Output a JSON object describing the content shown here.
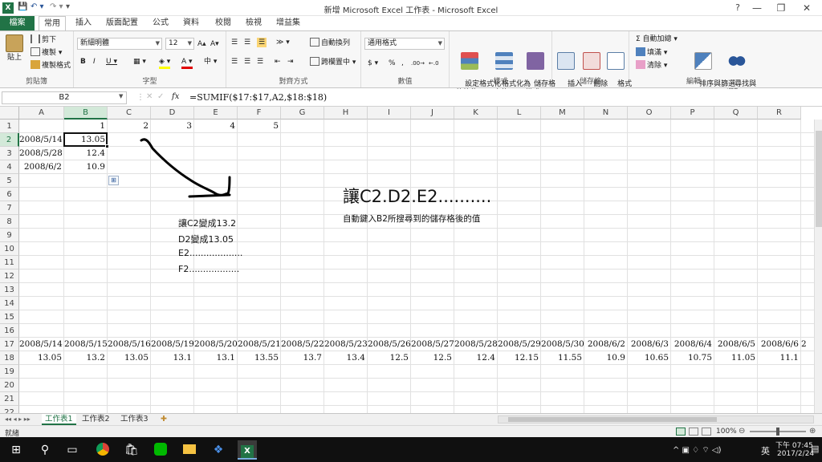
{
  "window": {
    "title": "新增 Microsoft Excel 工作表 - Microsoft Excel",
    "controls": {
      "help": "?",
      "minimize": "—",
      "restore": "❐",
      "close": "✕"
    }
  },
  "quick_access": {
    "save": "💾",
    "undo": "↶ ▾",
    "redo": "↷ ▾",
    "customize": "▾"
  },
  "ribbon_tabs": [
    "檔案",
    "常用",
    "插入",
    "版面配置",
    "公式",
    "資料",
    "校閱",
    "檢視",
    "增益集"
  ],
  "ribbon": {
    "clipboard": {
      "label": "剪貼簿",
      "paste": "貼上",
      "cut": "剪下",
      "copy": "複製 ▾",
      "format_painter": "複製格式"
    },
    "font": {
      "label": "字型",
      "font_name": "新細明體",
      "font_size": "12",
      "bold": "B",
      "italic": "I",
      "underline": "U ▾",
      "grow": "A▴",
      "shrink": "A▾",
      "border": "▦ ▾",
      "fill": "◈ ▾",
      "color": "A ▾",
      "phonetic": "中 ▾"
    },
    "alignment": {
      "label": "對齊方式",
      "wrap": "自動換列",
      "merge": "跨欄置中 ▾",
      "orientation": "≫ ▾"
    },
    "number": {
      "label": "數值",
      "format": "通用格式",
      "currency": "$ ▾",
      "percent": "%",
      "comma": ",",
      "inc": ".00→",
      "dec": "←.0"
    },
    "styles": {
      "label": "樣式",
      "conditional": "設定格式化\n的條件 ▾",
      "as_table": "格式化為\n表格 ▾",
      "cell_styles": "儲存格\n樣式 ▾"
    },
    "cells": {
      "label": "儲存格",
      "insert": "插入\n▾",
      "delete": "刪除\n▾",
      "format": "格式\n▾"
    },
    "editing": {
      "label": "編輯",
      "autosum": "Σ 自動加總 ▾",
      "fill": "填滿 ▾",
      "clear": "清除 ▾",
      "sort": "排序與篩選\n▾",
      "find": "尋找與\n選取 ▾"
    }
  },
  "formula_bar": {
    "name_box": "B2",
    "fx": "fx",
    "formula": "=SUMIF($17:$17,A2,$18:$18)"
  },
  "columns": [
    "A",
    "B",
    "C",
    "D",
    "E",
    "F",
    "G",
    "H",
    "I",
    "J",
    "K",
    "L",
    "M",
    "N",
    "O",
    "P",
    "Q",
    "R"
  ],
  "rows": [
    "1",
    "2",
    "3",
    "4",
    "5",
    "6",
    "7",
    "8",
    "9",
    "10",
    "11",
    "12",
    "13",
    "14",
    "15",
    "16",
    "17",
    "18",
    "19",
    "20",
    "21",
    "22",
    "23"
  ],
  "selected": {
    "column": "B",
    "row": "2"
  },
  "cells": {
    "B1": "1",
    "C1": "2",
    "D1": "3",
    "E1": "4",
    "F1": "5",
    "A2": "2008/5/14",
    "B2": "13.05",
    "A3": "2008/5/28",
    "B3": "12.4",
    "A4": "2008/6/2",
    "B4": "10.9"
  },
  "row17": [
    "2008/5/14",
    "2008/5/15",
    "2008/5/16",
    "2008/5/19",
    "2008/5/20",
    "2008/5/21",
    "2008/5/22",
    "2008/5/23",
    "2008/5/26",
    "2008/5/27",
    "2008/5/28",
    "2008/5/29",
    "2008/5/30",
    "2008/6/2",
    "2008/6/3",
    "2008/6/4",
    "2008/6/5",
    "2008/6/6"
  ],
  "row18": [
    "13.05",
    "13.2",
    "13.05",
    "13.1",
    "13.1",
    "13.55",
    "13.7",
    "13.4",
    "12.5",
    "12.5",
    "12.4",
    "12.15",
    "11.55",
    "10.9",
    "10.65",
    "10.75",
    "11.05",
    "11.1"
  ],
  "overflow_col_marker": "2",
  "notes": {
    "big": "讓C2.D2.E2..........",
    "sub": "自動鍵入B2所搜尋到的儲存格後的值",
    "line1": "讓C2變成13.2",
    "line2": "D2變成13.05",
    "line3": "E2...................",
    "line4": "F2.................."
  },
  "sheet_tabs": [
    "工作表1",
    "工作表2",
    "工作表3"
  ],
  "sheet_nav": "◂◂ ◂ ▸ ▸▸",
  "status": {
    "ready": "就緒",
    "zoom": "100%",
    "minus": "⊖",
    "plus": "⊕"
  },
  "taskbar": {
    "time": "下午 07:45",
    "date": "2017/2/24",
    "ime": "英",
    "tray_icons": "^  ▣  ♢  ⌔  ◁)"
  }
}
